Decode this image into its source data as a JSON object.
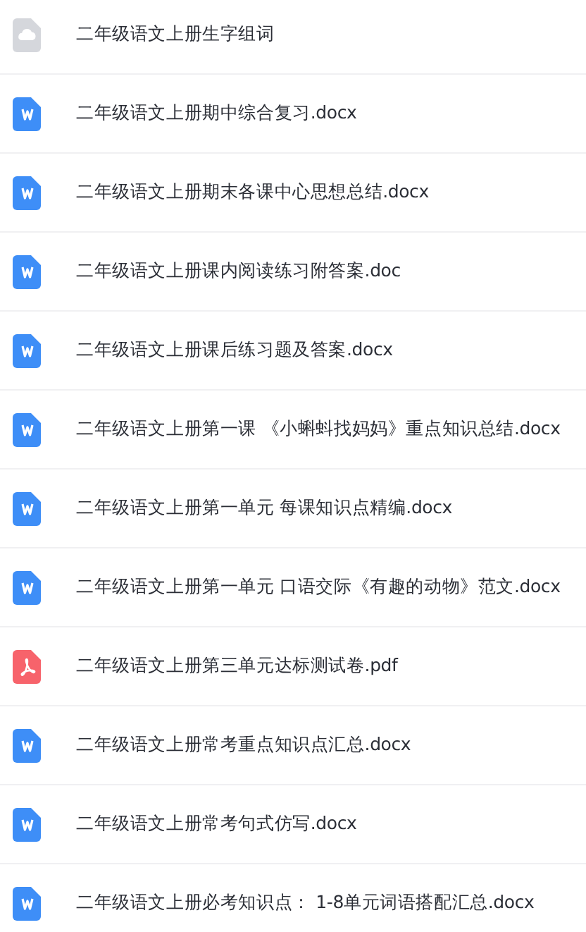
{
  "files": [
    {
      "kind": "cloud",
      "name": "二年级语文上册生字组词"
    },
    {
      "kind": "word",
      "name": "二年级语文上册期中综合复习.docx"
    },
    {
      "kind": "word",
      "name": "二年级语文上册期末各课中心思想总结.docx"
    },
    {
      "kind": "word",
      "name": "二年级语文上册课内阅读练习附答案.doc"
    },
    {
      "kind": "word",
      "name": "二年级语文上册课后练习题及答案.docx"
    },
    {
      "kind": "word",
      "name": "二年级语文上册第一课 《小蝌蚪找妈妈》重点知识总结.docx"
    },
    {
      "kind": "word",
      "name": "二年级语文上册第一单元 每课知识点精编.docx"
    },
    {
      "kind": "word",
      "name": "二年级语文上册第一单元 口语交际《有趣的动物》范文.docx"
    },
    {
      "kind": "pdf",
      "name": "二年级语文上册第三单元达标测试卷.pdf"
    },
    {
      "kind": "word",
      "name": "二年级语文上册常考重点知识点汇总.docx"
    },
    {
      "kind": "word",
      "name": "二年级语文上册常考句式仿写.docx"
    },
    {
      "kind": "word",
      "name": "二年级语文上册必考知识点： 1-8单元词语搭配汇总.docx"
    }
  ]
}
